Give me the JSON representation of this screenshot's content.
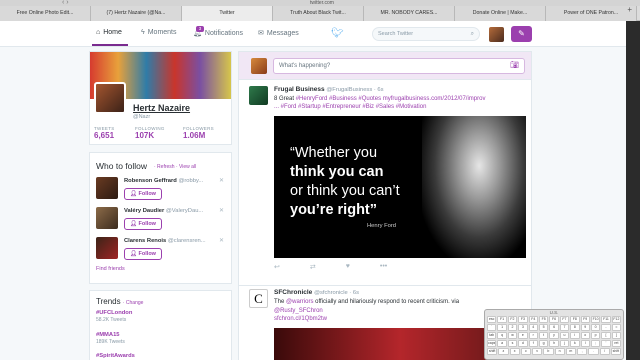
{
  "browser": {
    "url": "twitter.com",
    "tabs": [
      {
        "label": "Free Online Photo Edit..."
      },
      {
        "label": "(7) Hertz Nazaire (@Na..."
      },
      {
        "label": "Twitter"
      },
      {
        "label": "Truth About Black Twit..."
      },
      {
        "label": "MR. NOBODY CARES..."
      },
      {
        "label": "Donate Online | Make..."
      },
      {
        "label": "Power of ONE Patron..."
      }
    ]
  },
  "topbar": {
    "home": "Home",
    "moments": "Moments",
    "notifications": "Notifications",
    "notif_count": "3",
    "messages": "Messages",
    "search_placeholder": "Search Twitter"
  },
  "profile": {
    "name": "Hertz Nazaire",
    "handle": "@Nazr",
    "stats": [
      {
        "label": "TWEETS",
        "value": "6,651"
      },
      {
        "label": "FOLLOWING",
        "value": "107K"
      },
      {
        "label": "FOLLOWERS",
        "value": "1.06M"
      }
    ]
  },
  "who_to_follow": {
    "title": "Who to follow",
    "refresh": "· Refresh · View all",
    "users": [
      {
        "name": "Robenson Geffrard",
        "handle": "@robby...",
        "follow": "Follow"
      },
      {
        "name": "Valéry Daudier",
        "handle": "@ValeryDau...",
        "follow": "Follow"
      },
      {
        "name": "Clarens Renois",
        "handle": "@clarensren...",
        "follow": "Follow"
      }
    ],
    "find_friends": "Find friends"
  },
  "trends": {
    "title": "Trends",
    "change": "· Change",
    "items": [
      {
        "tag": "#UFCLondon",
        "count": "58.2K Tweets"
      },
      {
        "tag": "#MMA15",
        "count": "189K Tweets"
      },
      {
        "tag": "#SpiritAwards",
        "count": ""
      }
    ]
  },
  "compose": {
    "placeholder": "What's happening?"
  },
  "tweets": [
    {
      "name": "Frugal Business",
      "handle": "@FrugalBusiness · 6s",
      "text_plain": "8 Great ",
      "text_tags": "#HenryFord #Business #Quotes",
      "text_link": " myfrugalbusiness.com/2012/07/improv",
      "text_line2": "... #Ford #Startup #Entrepreneur #Biz #Sales #Motivation",
      "image_quote": {
        "line1": "“Whether you",
        "line2": "think you can",
        "line3": "or think you can’t",
        "line4": "you’re right”",
        "author": "Henry Ford"
      }
    },
    {
      "name": "SFChronicle",
      "handle": "@sfchronicle · 6s",
      "text_a": "The ",
      "text_mention": "@warriors",
      "text_b": " officially and hilariously respond to recent criticism. via",
      "text_via": "@Rusty_SFChron",
      "text_link": "sfchron.cl/1Qbm2tw"
    }
  ],
  "keyboard": {
    "title": "U.S.",
    "rows": [
      [
        "esc",
        "F1",
        "F2",
        "F3",
        "F4",
        "F5",
        "F6",
        "F7",
        "F8",
        "F9",
        "F10",
        "F11",
        "F12"
      ],
      [
        "`",
        "1",
        "2",
        "3",
        "4",
        "5",
        "6",
        "7",
        "8",
        "9",
        "0",
        "-",
        "="
      ],
      [
        "tab",
        "q",
        "w",
        "e",
        "r",
        "t",
        "y",
        "u",
        "i",
        "o",
        "p",
        "[",
        "]"
      ],
      [
        "caps",
        "a",
        "s",
        "d",
        "f",
        "g",
        "h",
        "j",
        "k",
        "l",
        ";",
        "'",
        "ret"
      ],
      [
        "shift",
        "z",
        "x",
        "c",
        "v",
        "b",
        "n",
        "m",
        ",",
        ".",
        "/",
        "shift"
      ]
    ]
  },
  "colors": {
    "accent": "#9b3fae",
    "twitter_blue": "#55acee"
  }
}
